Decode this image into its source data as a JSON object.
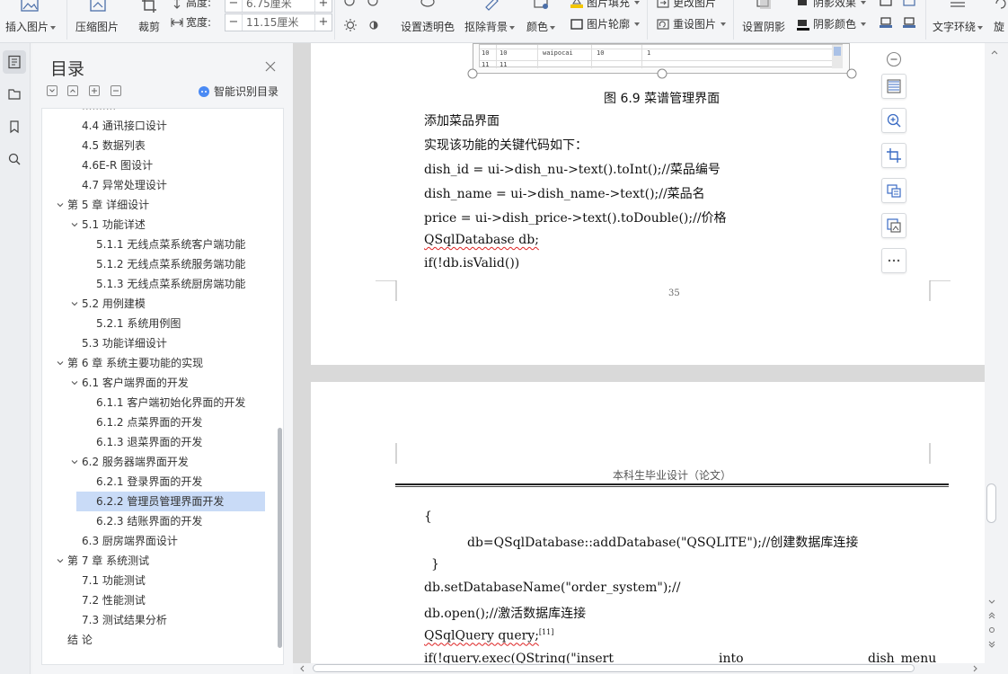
{
  "ribbon": {
    "insert_picture": "插入图片",
    "compress_picture": "压缩图片",
    "crop": "裁剪",
    "height_label": "高度:",
    "height_value": "6.75厘米",
    "width_label": "宽度:",
    "width_value": "11.15厘米",
    "set_transparent": "设置透明色",
    "remove_background": "抠除背景",
    "color": "颜色",
    "picture_outline": "图片轮廓",
    "picture_fill": "图片填充",
    "change_picture": "更改图片",
    "reset_picture": "重设图片",
    "set_shadow": "设置阴影",
    "shadow_effect": "阴影效果",
    "shadow_color": "阴影颜色",
    "text_wrap": "文字环绕",
    "rotate": "旋"
  },
  "toc": {
    "title": "目录",
    "ai_label": "智能识别目录",
    "items": [
      {
        "text": "4.4 通讯接口设计",
        "level": 2
      },
      {
        "text": "4.5 数据列表",
        "level": 2
      },
      {
        "text": "4.6E-R 图设计",
        "level": 2
      },
      {
        "text": "4.7 异常处理设计",
        "level": 2
      },
      {
        "text": "第 5 章  详细设计",
        "level": 1
      },
      {
        "text": "5.1 功能详述",
        "level": 2
      },
      {
        "text": "5.1.1 无线点菜系统客户端功能",
        "level": 3
      },
      {
        "text": "5.1.2 无线点菜系统服务端功能",
        "level": 3
      },
      {
        "text": "5.1.3 无线点菜系统厨房端功能",
        "level": 3
      },
      {
        "text": "5.2 用例建模",
        "level": 2
      },
      {
        "text": "5.2.1 系统用例图",
        "level": 3
      },
      {
        "text": "5.3 功能详细设计",
        "level": 2
      },
      {
        "text": "第 6 章  系统主要功能的实现",
        "level": 1
      },
      {
        "text": "6.1 客户端界面的开发",
        "level": 2
      },
      {
        "text": "6.1.1 客户端初始化界面的开发",
        "level": 3
      },
      {
        "text": "6.1.2 点菜界面的开发",
        "level": 3
      },
      {
        "text": "6.1.3 退菜界面的开发",
        "level": 3
      },
      {
        "text": "6.2  服务器端界面开发",
        "level": 2
      },
      {
        "text": "6.2.1  登录界面的开发",
        "level": 3
      },
      {
        "text": "6.2.2 管理员管理界面开发",
        "level": 3
      },
      {
        "text": "6.2.3 结账界面的开发",
        "level": 3
      },
      {
        "text": "6.3 厨房端界面设计",
        "level": 2
      },
      {
        "text": "第 7 章  系统测试",
        "level": 1
      },
      {
        "text": "7.1 功能测试",
        "level": 2
      },
      {
        "text": "7.2 性能测试",
        "level": 2
      },
      {
        "text": "7.3 测试结果分析",
        "level": 2
      },
      {
        "text": "结  论",
        "level": 1
      }
    ]
  },
  "page1": {
    "caption": "图 6.9  菜谱管理界面",
    "img_cells": [
      [
        "10",
        "10",
        "waipocai",
        "10",
        "1"
      ],
      [
        "11",
        "11",
        "",
        "",
        ""
      ]
    ],
    "lines": [
      "添加菜品界面",
      "实现该功能的关键代码如下：",
      "dish_id = ui->dish_nu->text().toInt();//菜品编号",
      "dish_name = ui->dish_name->text();//菜品名",
      "price = ui->dish_price->text().toDouble();//价格",
      "QSqlDatabase db;",
      "if(!db.isValid())"
    ],
    "page_number": "35"
  },
  "page2": {
    "header": "本科生毕业设计（论文）",
    "lines": [
      "{",
      "db=QSqlDatabase::addDatabase(\"QSQLITE\");//创建数据库连接",
      "}",
      "db.setDatabaseName(\"order_system\");//",
      "db.open();//激活数据库连接",
      "QSqlQuery query;",
      "if(!query.exec(QString(\"insert",
      "into",
      "dish_menu"
    ],
    "citation": "[11]"
  }
}
